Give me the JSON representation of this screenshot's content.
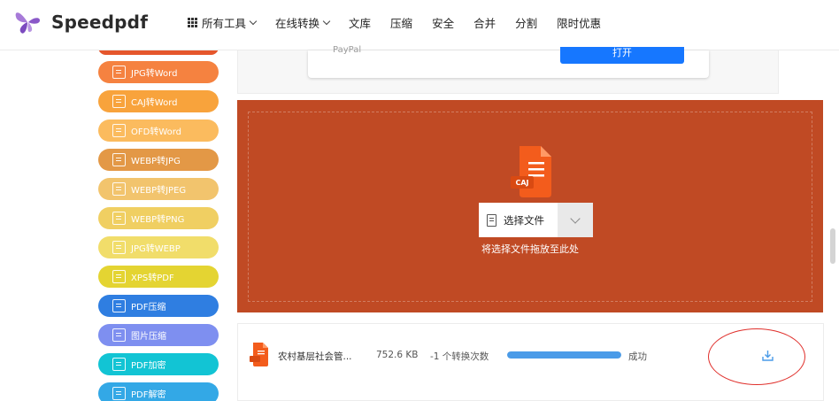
{
  "brand": {
    "name": "Speedpdf",
    "logo_icon": "butterfly-logo-icon",
    "logo_color": "#9a5fd0"
  },
  "nav": [
    {
      "label": "所有工具",
      "icon": "grid-icon",
      "dropdown": true
    },
    {
      "label": "在线转换",
      "dropdown": true
    },
    {
      "label": "文库"
    },
    {
      "label": "压缩"
    },
    {
      "label": "安全"
    },
    {
      "label": "合并"
    },
    {
      "label": "分割"
    },
    {
      "label": "限时优惠"
    }
  ],
  "sidebar": {
    "items": [
      {
        "label": "JPG转Word",
        "color": "#f58240"
      },
      {
        "label": "CAJ转Word",
        "color": "#f8a33c"
      },
      {
        "label": "OFD转Word",
        "color": "#fbbb5e"
      },
      {
        "label": "WEBP转JPG",
        "color": "#e39846"
      },
      {
        "label": "WEBP转JPEG",
        "color": "#f2c46d"
      },
      {
        "label": "WEBP转PNG",
        "color": "#f0cf62"
      },
      {
        "label": "JPG转WEBP",
        "color": "#f1dd6a"
      },
      {
        "label": "XPS转PDF",
        "color": "#e4d432"
      },
      {
        "label": "PDF压缩",
        "color": "#2f7ee1"
      },
      {
        "label": "图片压缩",
        "color": "#7e8ff0"
      },
      {
        "label": "PDF加密",
        "color": "#12c4d4"
      },
      {
        "label": "PDF解密",
        "color": "#33a8e6"
      }
    ]
  },
  "top_card": {
    "label": "PayPal",
    "button": "打开"
  },
  "upload": {
    "file_type_badge": "CAJ",
    "select_button": "选择文件",
    "hint": "将选择文件拖放至此处",
    "bg_color": "#c04a24"
  },
  "file_row": {
    "name": "农村基层社会管...",
    "size": "752.6 KB",
    "conversions": "-1 个转换次数",
    "progress": 1.0,
    "status": "成功",
    "download_icon": "download-icon"
  }
}
